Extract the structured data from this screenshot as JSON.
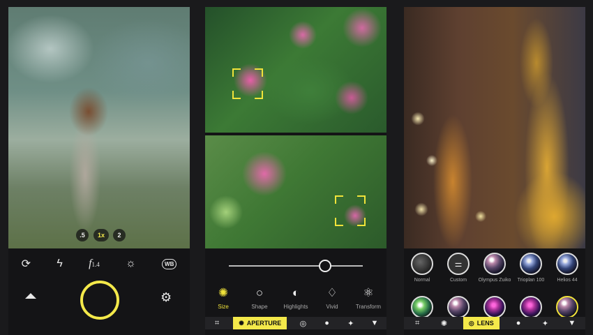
{
  "panel1": {
    "zoom_options": [
      ".5",
      "1x",
      "2"
    ],
    "tools": {
      "rotate": "⟳",
      "flash": "ϟ",
      "aperture": "f",
      "aperture_value": "1.4",
      "exposure": "☼",
      "wb": "WB"
    },
    "gear": "⚙"
  },
  "panel2": {
    "slider_value": 0.72,
    "modes": [
      {
        "label": "Size",
        "icon": "aperture-icon",
        "glyph": "✺",
        "active": true
      },
      {
        "label": "Shape",
        "icon": "circle-icon",
        "glyph": "○",
        "active": false
      },
      {
        "label": "Highlights",
        "icon": "highlights-icon",
        "glyph": "◐",
        "active": false
      },
      {
        "label": "Vivid",
        "icon": "paint-bucket-icon",
        "glyph": "♢",
        "active": false
      },
      {
        "label": "Transform",
        "icon": "atom-icon",
        "glyph": "⚛",
        "active": false
      }
    ],
    "bottom_bar": {
      "active_label": "APERTURE",
      "icons": [
        "⌗",
        "◎",
        "●",
        "✦",
        "▼"
      ]
    }
  },
  "panel3": {
    "lenses_row1": [
      {
        "label": "Normal",
        "style": "normal"
      },
      {
        "label": "Custom",
        "style": "custom",
        "glyph": "⚌"
      },
      {
        "label": "Olympus Zuiko",
        "style": "glass"
      },
      {
        "label": "Trioplan 100",
        "style": "glass2"
      },
      {
        "label": "Helios 44",
        "style": "glass2"
      }
    ],
    "lenses_row2": [
      {
        "style": "glass4"
      },
      {
        "style": "glass"
      },
      {
        "style": "glass3"
      },
      {
        "style": "glass3"
      },
      {
        "style": "glass",
        "selected": true
      }
    ],
    "bottom_bar": {
      "active_label": "LENS",
      "icons": [
        "⌗",
        "✺",
        "●",
        "✦",
        "▼"
      ]
    }
  },
  "colors": {
    "accent": "#f4e94a",
    "background": "#1a1a1c"
  }
}
